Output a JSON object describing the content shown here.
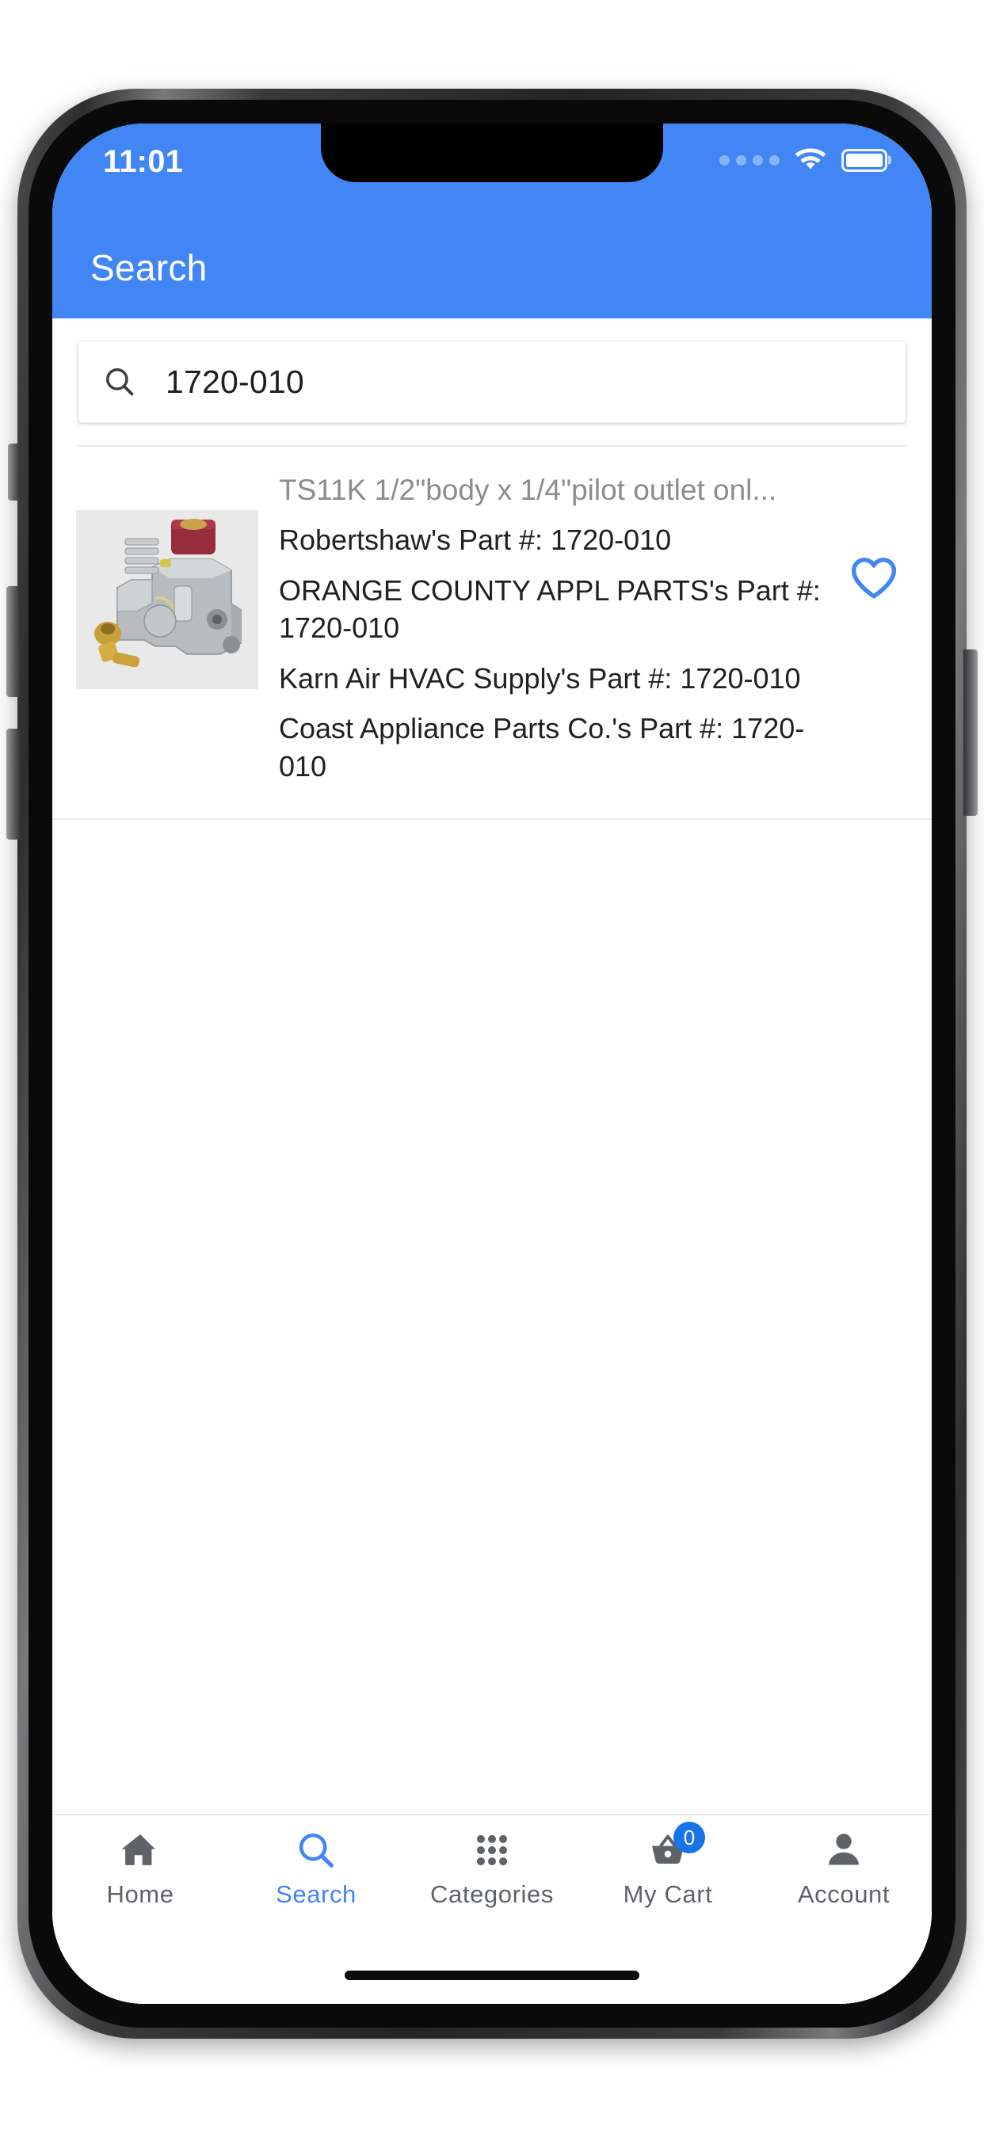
{
  "device": {
    "frame": "iphone",
    "home_indicator": true
  },
  "status_bar": {
    "time": "11:01",
    "signal_icon": "signal-dots-icon",
    "wifi_icon": "wifi-icon",
    "battery_icon": "battery-full-icon",
    "text_color": "#ffffff",
    "background": "#4285f4"
  },
  "app_bar": {
    "title": "Search",
    "background": "#4285f4",
    "title_color": "#ffffff"
  },
  "search": {
    "icon": "search-icon",
    "value": "1720-010",
    "placeholder": "Search"
  },
  "results": {
    "items": [
      {
        "title": "TS11K 1/2\"body x 1/4\"pilot outlet onl...",
        "image_alt": "gas-safety-valve",
        "favorite_icon": "heart-outline-icon",
        "favorited": false,
        "part_numbers": [
          "Robertshaw's Part #: 1720-010",
          "ORANGE COUNTY APPL PARTS's Part #: 1720-010",
          "Karn Air HVAC Supply's Part #: 1720-010",
          "Coast Appliance Parts Co.'s Part #: 1720-010"
        ]
      }
    ]
  },
  "bottom_nav": {
    "active_index": 1,
    "active_color": "#4285f4",
    "inactive_color": "#5f6368",
    "items": [
      {
        "label": "Home",
        "icon": "home-icon"
      },
      {
        "label": "Search",
        "icon": "search-icon"
      },
      {
        "label": "Categories",
        "icon": "grid-icon"
      },
      {
        "label": "My Cart",
        "icon": "basket-icon",
        "badge": "0"
      },
      {
        "label": "Account",
        "icon": "person-icon"
      }
    ]
  }
}
